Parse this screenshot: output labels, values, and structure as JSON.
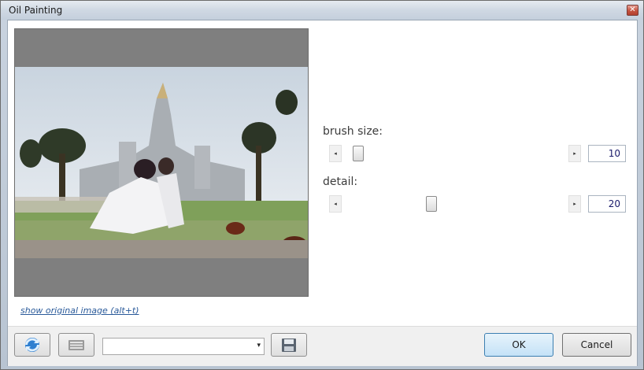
{
  "window": {
    "title": "Oil Painting",
    "close_glyph": "✕"
  },
  "preview": {
    "link_text": "show original image (alt+t)"
  },
  "controls": {
    "brush": {
      "label": "brush size:",
      "value": "10",
      "level": 0.06
    },
    "detail": {
      "label": "detail:",
      "value": "20",
      "level": 0.43
    }
  },
  "icons": {
    "refresh": "refresh-icon",
    "keyboard": "keyboard-icon",
    "save": "save-icon",
    "left_arrow": "◂",
    "right_arrow": "▸",
    "dropdown": "▾"
  },
  "combo": {
    "value": ""
  },
  "buttons": {
    "ok": "OK",
    "cancel": "Cancel"
  },
  "colors": {
    "ok_accent": "#c4e2f7",
    "link": "#2a5a9a",
    "close": "#c4523f"
  }
}
